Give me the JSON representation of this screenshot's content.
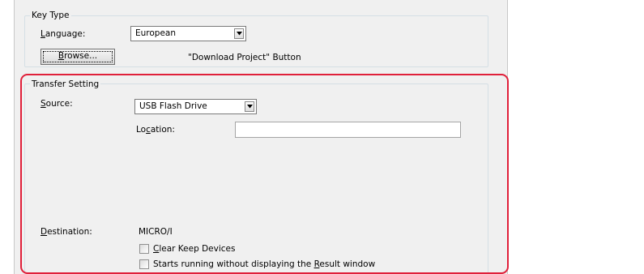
{
  "key_type": {
    "group_title": "Key Type",
    "language_label_first": "L",
    "language_label_rest": "anguage:",
    "language_value": "European",
    "browse_label_first": "B",
    "browse_label_rest": "rowse...",
    "download_note": "\"Download Project\"  Button"
  },
  "transfer_setting": {
    "group_title": "Transfer Setting",
    "source_label_first": "S",
    "source_label_rest": "ource:",
    "source_value": "USB Flash Drive",
    "location_label_pre": "Lo",
    "location_label_ul": "c",
    "location_label_post": "ation:",
    "location_value": "",
    "destination_label_first": "D",
    "destination_label_rest": "estination:",
    "destination_value": "MICRO/I",
    "clear_keep_first": "C",
    "clear_keep_rest": "lear Keep Devices",
    "clear_keep_checked": false,
    "starts_running_pre": "Starts running without displaying the ",
    "starts_running_ul": "R",
    "starts_running_post": "esult window",
    "starts_running_checked": false
  },
  "colors": {
    "highlight": "#e0203a",
    "dialog_background": "#f0f0f0"
  },
  "icons": {
    "dropdown": "chevron-down-icon"
  }
}
